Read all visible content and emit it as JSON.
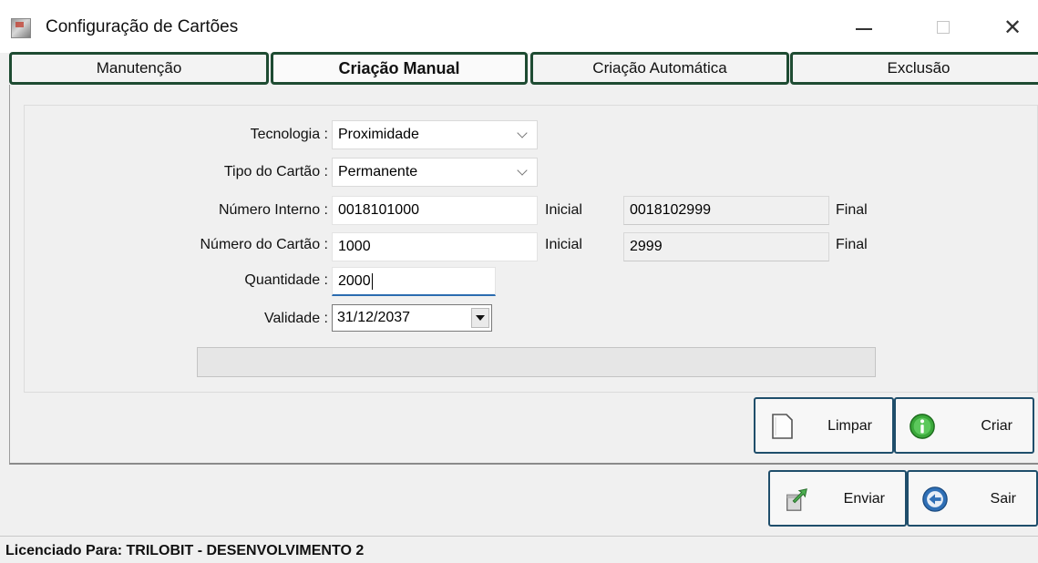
{
  "window": {
    "title": "Configuração de Cartões",
    "icon": "app-card-icon",
    "controls": [
      "minimize-icon",
      "maximize-icon",
      "close-icon"
    ],
    "close_glyph": "✕"
  },
  "tabs": [
    {
      "label": "Manutenção",
      "active": false
    },
    {
      "label": "Criação Manual",
      "active": true
    },
    {
      "label": "Criação Automática",
      "active": false
    },
    {
      "label": "Exclusão",
      "active": false
    }
  ],
  "form": {
    "tecnologia": {
      "label": "Tecnologia :",
      "value": "Proximidade"
    },
    "tipo_cartao": {
      "label": "Tipo do Cartão :",
      "value": "Permanente"
    },
    "numero_interno": {
      "label": "Número Interno :",
      "inicial_value": "0018101000",
      "inicial_label": "Inicial",
      "final_value": "0018102999",
      "final_label": "Final"
    },
    "numero_cartao": {
      "label": "Número do Cartão :",
      "inicial_value": "1000",
      "inicial_label": "Inicial",
      "final_value": "2999",
      "final_label": "Final"
    },
    "quantidade": {
      "label": "Quantidade :",
      "value": "2000"
    },
    "validade": {
      "label": "Validade :",
      "value": "31/12/2037"
    },
    "progress": 0
  },
  "buttons": {
    "limpar": "Limpar",
    "criar": "Criar",
    "enviar": "Enviar",
    "sair": "Sair"
  },
  "colors": {
    "tab_border": "#1e4b32",
    "button_border": "#1f4e6b",
    "focus_underline": "#2b6cb0"
  },
  "status_bar": "Licenciado Para: TRILOBIT - DESENVOLVIMENTO 2"
}
